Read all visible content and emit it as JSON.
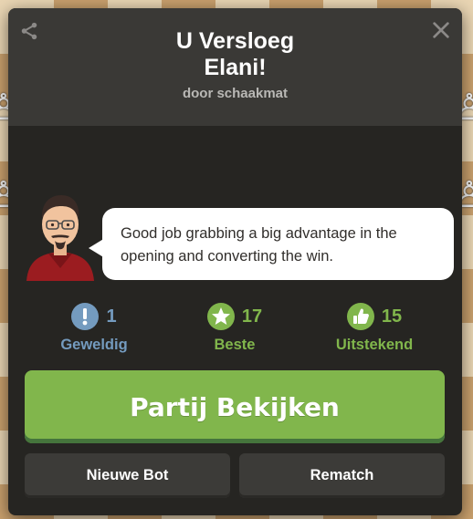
{
  "modal": {
    "title_line1": "U Versloeg",
    "title_line2": "Elani!",
    "subtitle": "door schaakmat"
  },
  "coach": {
    "message": "Good job grabbing a big advantage in the opening and converting the win."
  },
  "stats": [
    {
      "count": "1",
      "label": "Geweldig",
      "icon": "exclamation-icon",
      "color": "#749bbf"
    },
    {
      "count": "17",
      "label": "Beste",
      "icon": "star-icon",
      "color": "#81b64c"
    },
    {
      "count": "15",
      "label": "Uitstekend",
      "icon": "thumbs-up-icon",
      "color": "#81b64c"
    }
  ],
  "buttons": {
    "review": "Partij Bekijken",
    "new_bot": "Nieuwe Bot",
    "rematch": "Rematch"
  },
  "colors": {
    "accent_green": "#81b64c",
    "brilliant_blue": "#749bbf",
    "modal_bg": "#262522",
    "header_bg": "#3a3936"
  }
}
